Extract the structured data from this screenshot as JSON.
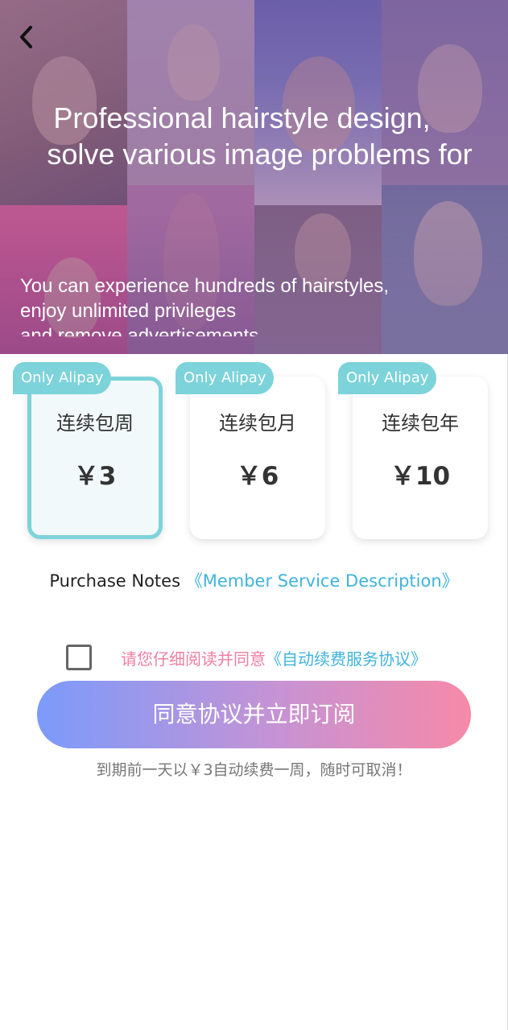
{
  "hero": {
    "title_line1": "Professional hairstyle design,",
    "title_line2": "solve various image problems for",
    "subtitle_lines": [
      "You can experience hundreds of hairstyles,",
      "enjoy unlimited privileges",
      "and remove advertisements"
    ]
  },
  "nav": {
    "back_icon": "chevron-left-icon"
  },
  "plans": [
    {
      "badge": "Only Alipay",
      "name": "连续包周",
      "price": "￥3",
      "selected": true
    },
    {
      "badge": "Only Alipay",
      "name": "连续包月",
      "price": "￥6",
      "selected": false
    },
    {
      "badge": "Only Alipay",
      "name": "连续包年",
      "price": "￥10",
      "selected": false
    }
  ],
  "notes": {
    "label": "Purchase Notes",
    "link": "《Member Service Description》"
  },
  "agreement": {
    "checked": false,
    "text": "请您仔细阅读并同意",
    "link": "《自动续费服务协议》"
  },
  "subscribe_button": "同意协议并立即订阅",
  "footnote": "到期前一天以￥3自动续费一周，随时可取消！",
  "colors": {
    "accent": "#7dd3da",
    "link": "#3fb3dc",
    "agree_text": "#ef7fa2",
    "button_start": "#7b9bfb",
    "button_end": "#f68aa8"
  }
}
